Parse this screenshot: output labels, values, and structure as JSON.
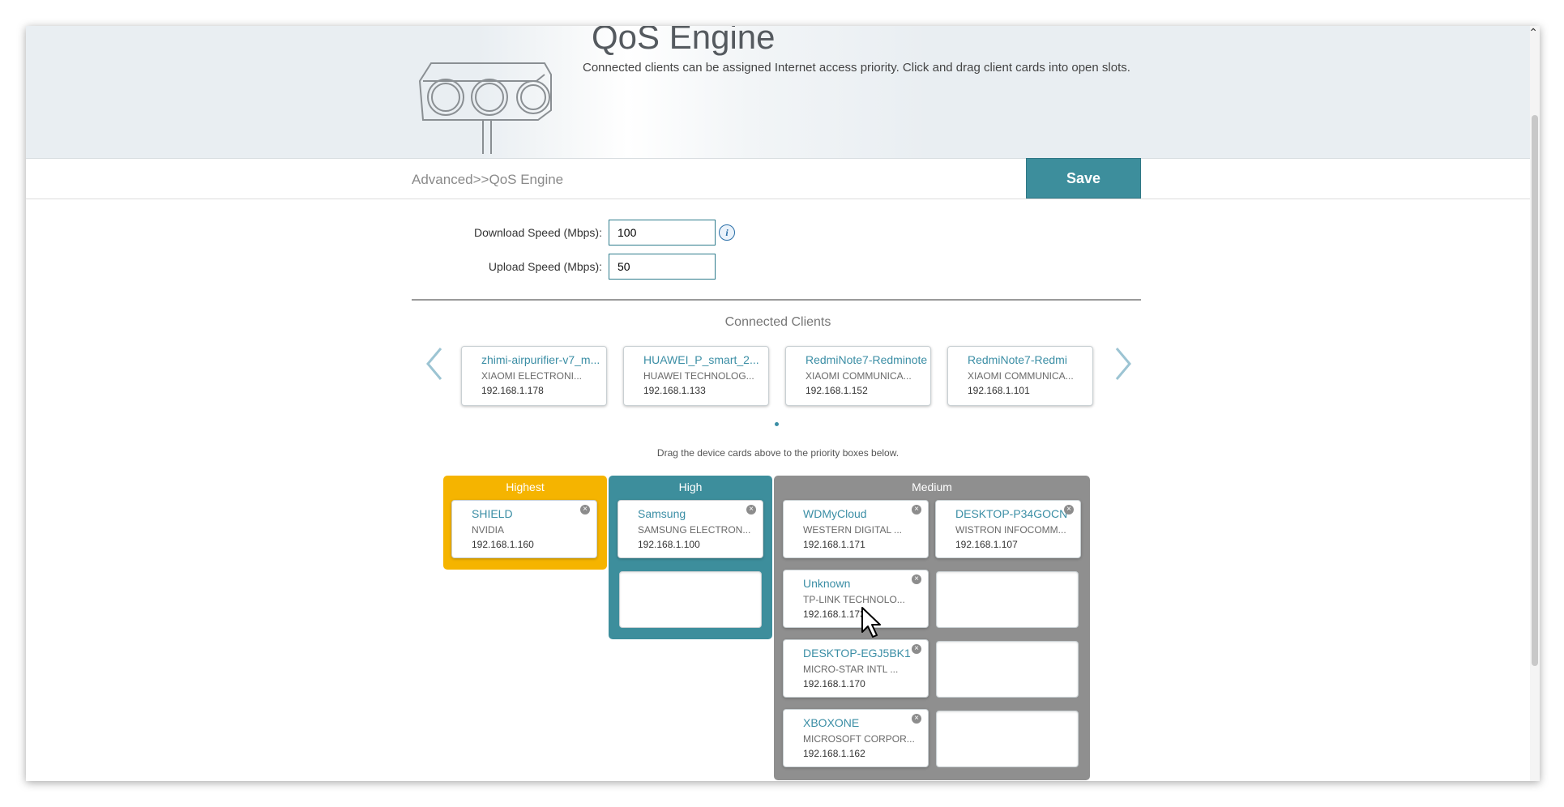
{
  "header": {
    "title": "QoS Engine",
    "subtitle": "Connected clients can be assigned Internet access priority. Click and drag client cards into open slots."
  },
  "breadcrumb": "Advanced>>QoS Engine",
  "save_label": "Save",
  "form": {
    "download_label": "Download Speed (Mbps):",
    "download_value": "100",
    "upload_label": "Upload Speed (Mbps):",
    "upload_value": "50"
  },
  "connected": {
    "title": "Connected Clients",
    "cards": [
      {
        "name": "zhimi-airpurifier-v7_m...",
        "vendor": "XIAOMI ELECTRONI...",
        "ip": "192.168.1.178"
      },
      {
        "name": "HUAWEI_P_smart_2...",
        "vendor": "HUAWEI TECHNOLOG...",
        "ip": "192.168.1.133"
      },
      {
        "name": "RedmiNote7-Redminote",
        "vendor": "XIAOMI COMMUNICA...",
        "ip": "192.168.1.152"
      },
      {
        "name": "RedmiNote7-Redmi",
        "vendor": "XIAOMI COMMUNICA...",
        "ip": "192.168.1.101"
      }
    ]
  },
  "drag_note": "Drag the device cards above to the priority boxes below.",
  "priority": {
    "highest": {
      "label": "Highest",
      "color": "#f5b400",
      "cards": [
        {
          "name": "SHIELD",
          "vendor": "NVIDIA",
          "ip": "192.168.1.160"
        }
      ]
    },
    "high": {
      "label": "High",
      "color": "#3d8e9c",
      "cards": [
        {
          "name": "Samsung",
          "vendor": "SAMSUNG ELECTRON...",
          "ip": "192.168.1.100"
        }
      ]
    },
    "medium": {
      "label": "Medium",
      "color": "#8f8f8f",
      "cards": [
        {
          "name": "WDMyCloud",
          "vendor": "WESTERN DIGITAL ...",
          "ip": "192.168.1.171"
        },
        {
          "name": "DESKTOP-P34GOCN",
          "vendor": "WISTRON INFOCOMM...",
          "ip": "192.168.1.107"
        },
        {
          "name": "Unknown",
          "vendor": "TP-LINK TECHNOLO...",
          "ip": "192.168.1.173"
        },
        {
          "name": "DESKTOP-EGJ5BK1",
          "vendor": "MICRO-STAR INTL ...",
          "ip": "192.168.1.170"
        },
        {
          "name": "XBOXONE",
          "vendor": "MICROSOFT CORPOR...",
          "ip": "192.168.1.162"
        }
      ]
    }
  },
  "icons": {
    "info": "info-icon",
    "remove": "close-circle-icon",
    "prev": "chevron-left-icon",
    "next": "chevron-right-icon"
  }
}
